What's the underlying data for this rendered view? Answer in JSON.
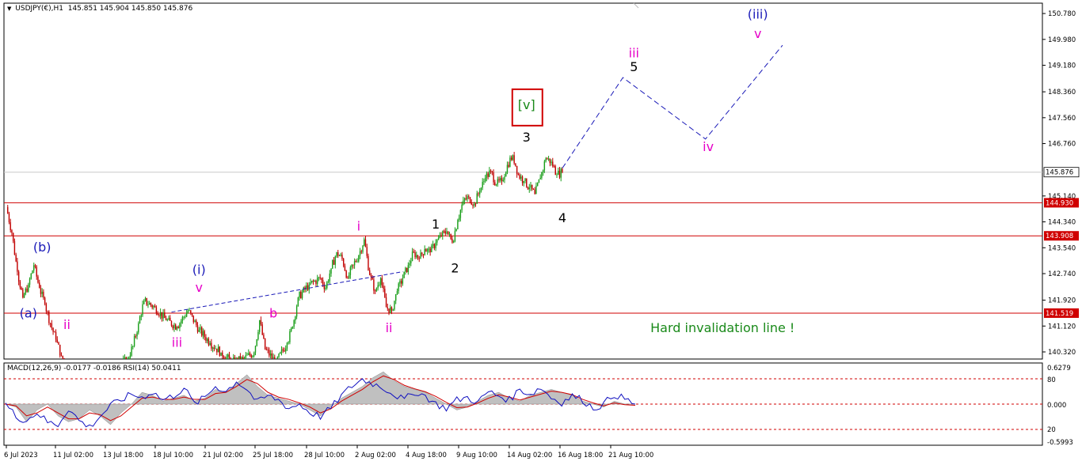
{
  "header": {
    "symbol": "USDJPY(€),H1",
    "ohlc": "145.851 145.904 145.850 145.876",
    "subwindow_label": "MACD(12,26,9) -0.0177 -0.0186 RSI(14) 50.0411"
  },
  "colors": {
    "bull": "#1a9e1a",
    "bear": "#c00000",
    "level_line": "#d00000",
    "projection": "#1a1ab8",
    "label_blue": "#1a1ab8",
    "label_magenta": "#e600c8",
    "label_black": "#000000",
    "label_green": "#1a8a1a",
    "macd_line": "#1010c0",
    "signal_line": "#d00000",
    "histogram": "#c0c0c0"
  },
  "chart_data": [
    {
      "type": "line",
      "title": "USDJPY(€),H1",
      "price_axis_ticks": [
        "150.780",
        "149.980",
        "149.180",
        "148.360",
        "147.560",
        "146.760",
        "145.140",
        "144.340",
        "143.540",
        "142.740",
        "141.920",
        "141.120",
        "140.320"
      ],
      "ylim": [
        140.1,
        151.1
      ],
      "time_axis_ticks": [
        "6 Jul 2023",
        "11 Jul 02:00",
        "13 Jul 18:00",
        "18 Jul 10:00",
        "21 Jul 02:00",
        "25 Jul 18:00",
        "28 Jul 10:00",
        "2 Aug 02:00",
        "4 Aug 18:00",
        "9 Aug 10:00",
        "14 Aug 02:00",
        "16 Aug 18:00",
        "21 Aug 10:00"
      ],
      "series": [
        {
          "values": [
            {
              "t": 0,
              "p": 144.8
            },
            {
              "t": 1,
              "p": 144.0
            },
            {
              "t": 2,
              "p": 142.8
            },
            {
              "t": 3,
              "p": 142.0
            },
            {
              "t": 4,
              "p": 142.4
            },
            {
              "t": 5,
              "p": 143.0
            },
            {
              "t": 6,
              "p": 142.3
            },
            {
              "t": 7,
              "p": 141.8
            },
            {
              "t": 8,
              "p": 141.2
            },
            {
              "t": 9,
              "p": 140.7
            },
            {
              "t": 10,
              "p": 140.2
            },
            {
              "t": 11,
              "p": 139.9
            },
            {
              "t": 20,
              "p": 139.8
            },
            {
              "t": 22,
              "p": 140.1
            },
            {
              "t": 23,
              "p": 140.5
            },
            {
              "t": 24,
              "p": 141.2
            },
            {
              "t": 25,
              "p": 141.9
            },
            {
              "t": 27,
              "p": 141.7
            },
            {
              "t": 29,
              "p": 141.3
            },
            {
              "t": 31,
              "p": 141.1
            },
            {
              "t": 33,
              "p": 141.6
            },
            {
              "t": 35,
              "p": 141.0
            },
            {
              "t": 37,
              "p": 140.6
            },
            {
              "t": 39,
              "p": 140.3
            },
            {
              "t": 41,
              "p": 140.0
            },
            {
              "t": 43,
              "p": 140.1
            },
            {
              "t": 45,
              "p": 140.3
            },
            {
              "t": 46,
              "p": 141.3
            },
            {
              "t": 47,
              "p": 140.4
            },
            {
              "t": 49,
              "p": 140.0
            },
            {
              "t": 51,
              "p": 140.6
            },
            {
              "t": 52,
              "p": 141.1
            },
            {
              "t": 53,
              "p": 142.0
            },
            {
              "t": 55,
              "p": 142.4
            },
            {
              "t": 57,
              "p": 142.6
            },
            {
              "t": 58,
              "p": 142.3
            },
            {
              "t": 59,
              "p": 142.9
            },
            {
              "t": 60,
              "p": 143.4
            },
            {
              "t": 61,
              "p": 143.2
            },
            {
              "t": 62,
              "p": 142.6
            },
            {
              "t": 63,
              "p": 143.0
            },
            {
              "t": 64,
              "p": 143.3
            },
            {
              "t": 65,
              "p": 143.8
            },
            {
              "t": 66,
              "p": 142.7
            },
            {
              "t": 67,
              "p": 142.2
            },
            {
              "t": 68,
              "p": 142.6
            },
            {
              "t": 69,
              "p": 141.7
            },
            {
              "t": 70,
              "p": 141.6
            },
            {
              "t": 71,
              "p": 142.2
            },
            {
              "t": 72,
              "p": 142.6
            },
            {
              "t": 73,
              "p": 143.0
            },
            {
              "t": 74,
              "p": 143.4
            },
            {
              "t": 75,
              "p": 143.2
            },
            {
              "t": 76,
              "p": 143.5
            },
            {
              "t": 77,
              "p": 143.4
            },
            {
              "t": 78,
              "p": 143.7
            },
            {
              "t": 79,
              "p": 143.9
            },
            {
              "t": 80,
              "p": 144.05
            },
            {
              "t": 81,
              "p": 143.7
            },
            {
              "t": 82,
              "p": 144.4
            },
            {
              "t": 83,
              "p": 145.0
            },
            {
              "t": 84,
              "p": 145.1
            },
            {
              "t": 85,
              "p": 144.9
            },
            {
              "t": 86,
              "p": 145.3
            },
            {
              "t": 87,
              "p": 145.7
            },
            {
              "t": 88,
              "p": 145.9
            },
            {
              "t": 89,
              "p": 145.5
            },
            {
              "t": 90,
              "p": 145.6
            },
            {
              "t": 91,
              "p": 146.1
            },
            {
              "t": 92,
              "p": 146.4
            },
            {
              "t": 93,
              "p": 145.8
            },
            {
              "t": 94,
              "p": 145.6
            },
            {
              "t": 95,
              "p": 145.4
            },
            {
              "t": 96,
              "p": 145.2
            },
            {
              "t": 97,
              "p": 145.7
            },
            {
              "t": 98,
              "p": 146.3
            },
            {
              "t": 99,
              "p": 146.2
            },
            {
              "t": 100,
              "p": 145.8
            },
            {
              "t": 101,
              "p": 145.88
            }
          ]
        }
      ],
      "horizontal_levels": [
        "144.930",
        "143.908",
        "141.519"
      ],
      "current_price": "145.876",
      "projection_path": [
        {
          "t": 101,
          "p": 146.0
        },
        {
          "t": 112,
          "p": 148.8
        },
        {
          "t": 127,
          "p": 146.9
        },
        {
          "t": 141,
          "p": 149.8
        }
      ],
      "wave_labels": [
        {
          "text": "(b)",
          "color": "blue",
          "t": 6.5,
          "p": 143.55
        },
        {
          "text": "(a)",
          "color": "blue",
          "t": 4,
          "p": 141.5
        },
        {
          "text": "ii",
          "color": "magenta",
          "t": 11,
          "p": 141.15
        },
        {
          "text": "(i)",
          "color": "blue",
          "t": 35,
          "p": 142.85
        },
        {
          "text": "v",
          "color": "magenta",
          "t": 35,
          "p": 142.3
        },
        {
          "text": "iii",
          "color": "magenta",
          "t": 31,
          "p": 140.6
        },
        {
          "text": "b",
          "color": "magenta",
          "t": 48.5,
          "p": 141.5
        },
        {
          "text": "i",
          "color": "magenta",
          "t": 64,
          "p": 144.2
        },
        {
          "text": "ii",
          "color": "magenta",
          "t": 69.5,
          "p": 141.05
        },
        {
          "text": "1",
          "color": "black",
          "t": 78,
          "p": 144.25
        },
        {
          "text": "2",
          "color": "black",
          "t": 81.5,
          "p": 142.9
        },
        {
          "text": "3",
          "color": "black",
          "t": 94.5,
          "p": 146.95
        },
        {
          "text": "4",
          "color": "black",
          "t": 101,
          "p": 144.45
        },
        {
          "text": "5",
          "color": "black",
          "t": 114,
          "p": 149.12
        },
        {
          "text": "iii",
          "color": "magenta",
          "t": 114,
          "p": 149.55
        },
        {
          "text": "iv",
          "color": "magenta",
          "t": 127.5,
          "p": 146.65
        },
        {
          "text": "v",
          "color": "magenta",
          "t": 136.5,
          "p": 150.15
        },
        {
          "text": "(iii)",
          "color": "blue",
          "t": 136.5,
          "p": 150.75
        },
        {
          "text": "[v]",
          "color": "green",
          "t": 94.5,
          "p": 147.95,
          "boxed": true
        }
      ],
      "annotations": [
        {
          "text": "Hard invalidation line !",
          "color": "green",
          "t": 117,
          "p": 141.05
        }
      ]
    },
    {
      "type": "line",
      "title": "MACD(12,26,9) -0.0177 -0.0186 RSI(14) 50.0411",
      "axis_ticks": [
        "0.6279",
        "80",
        "0.000",
        "20",
        "-0.5993"
      ],
      "ylim": [
        -0.7,
        0.7
      ],
      "dashed_levels": [
        0.43,
        0.0,
        -0.43
      ],
      "series": [
        {
          "name": "MACD",
          "values": [
            0.0,
            -0.05,
            -0.3,
            -0.1,
            0.0,
            -0.2,
            -0.3,
            -0.25,
            -0.1,
            -0.2,
            -0.35,
            -0.15,
            0.0,
            0.2,
            0.15,
            0.05,
            0.1,
            0.15,
            0.05,
            0.1,
            0.25,
            0.2,
            0.35,
            0.5,
            0.3,
            0.15,
            0.1,
            0.05,
            0.0,
            -0.1,
            -0.2,
            -0.05,
            0.1,
            0.2,
            0.3,
            0.45,
            0.55,
            0.4,
            0.3,
            0.25,
            0.2,
            0.1,
            0.0,
            -0.1,
            -0.05,
            0.05,
            0.15,
            0.2,
            0.1,
            0.05,
            0.15,
            0.2,
            0.25,
            0.2,
            0.15,
            0.05,
            0.0,
            -0.05,
            0.05,
            0.0,
            0.0
          ]
        },
        {
          "name": "Signal",
          "values": [
            0.0,
            -0.03,
            -0.2,
            -0.15,
            -0.05,
            -0.15,
            -0.25,
            -0.25,
            -0.15,
            -0.18,
            -0.28,
            -0.2,
            -0.05,
            0.1,
            0.12,
            0.08,
            0.08,
            0.12,
            0.08,
            0.08,
            0.18,
            0.2,
            0.3,
            0.42,
            0.35,
            0.2,
            0.12,
            0.08,
            0.02,
            -0.05,
            -0.15,
            -0.08,
            0.05,
            0.15,
            0.25,
            0.38,
            0.48,
            0.42,
            0.32,
            0.26,
            0.21,
            0.13,
            0.03,
            -0.06,
            -0.05,
            0.02,
            0.1,
            0.16,
            0.12,
            0.07,
            0.12,
            0.17,
            0.22,
            0.2,
            0.16,
            0.08,
            0.02,
            -0.03,
            0.02,
            -0.01,
            -0.02
          ]
        },
        {
          "name": "RSI",
          "values": [
            50,
            35,
            30,
            40,
            28,
            25,
            45,
            30,
            22,
            35,
            48,
            55,
            62,
            58,
            65,
            55,
            60,
            70,
            50,
            58,
            72,
            65,
            78,
            68,
            52,
            60,
            55,
            45,
            50,
            40,
            35,
            45,
            60,
            72,
            80,
            75,
            70,
            62,
            55,
            65,
            60,
            50,
            45,
            55,
            58,
            52,
            65,
            60,
            55,
            68,
            62,
            70,
            58,
            52,
            60,
            55,
            45,
            50,
            62,
            56,
            50
          ]
        }
      ]
    }
  ]
}
